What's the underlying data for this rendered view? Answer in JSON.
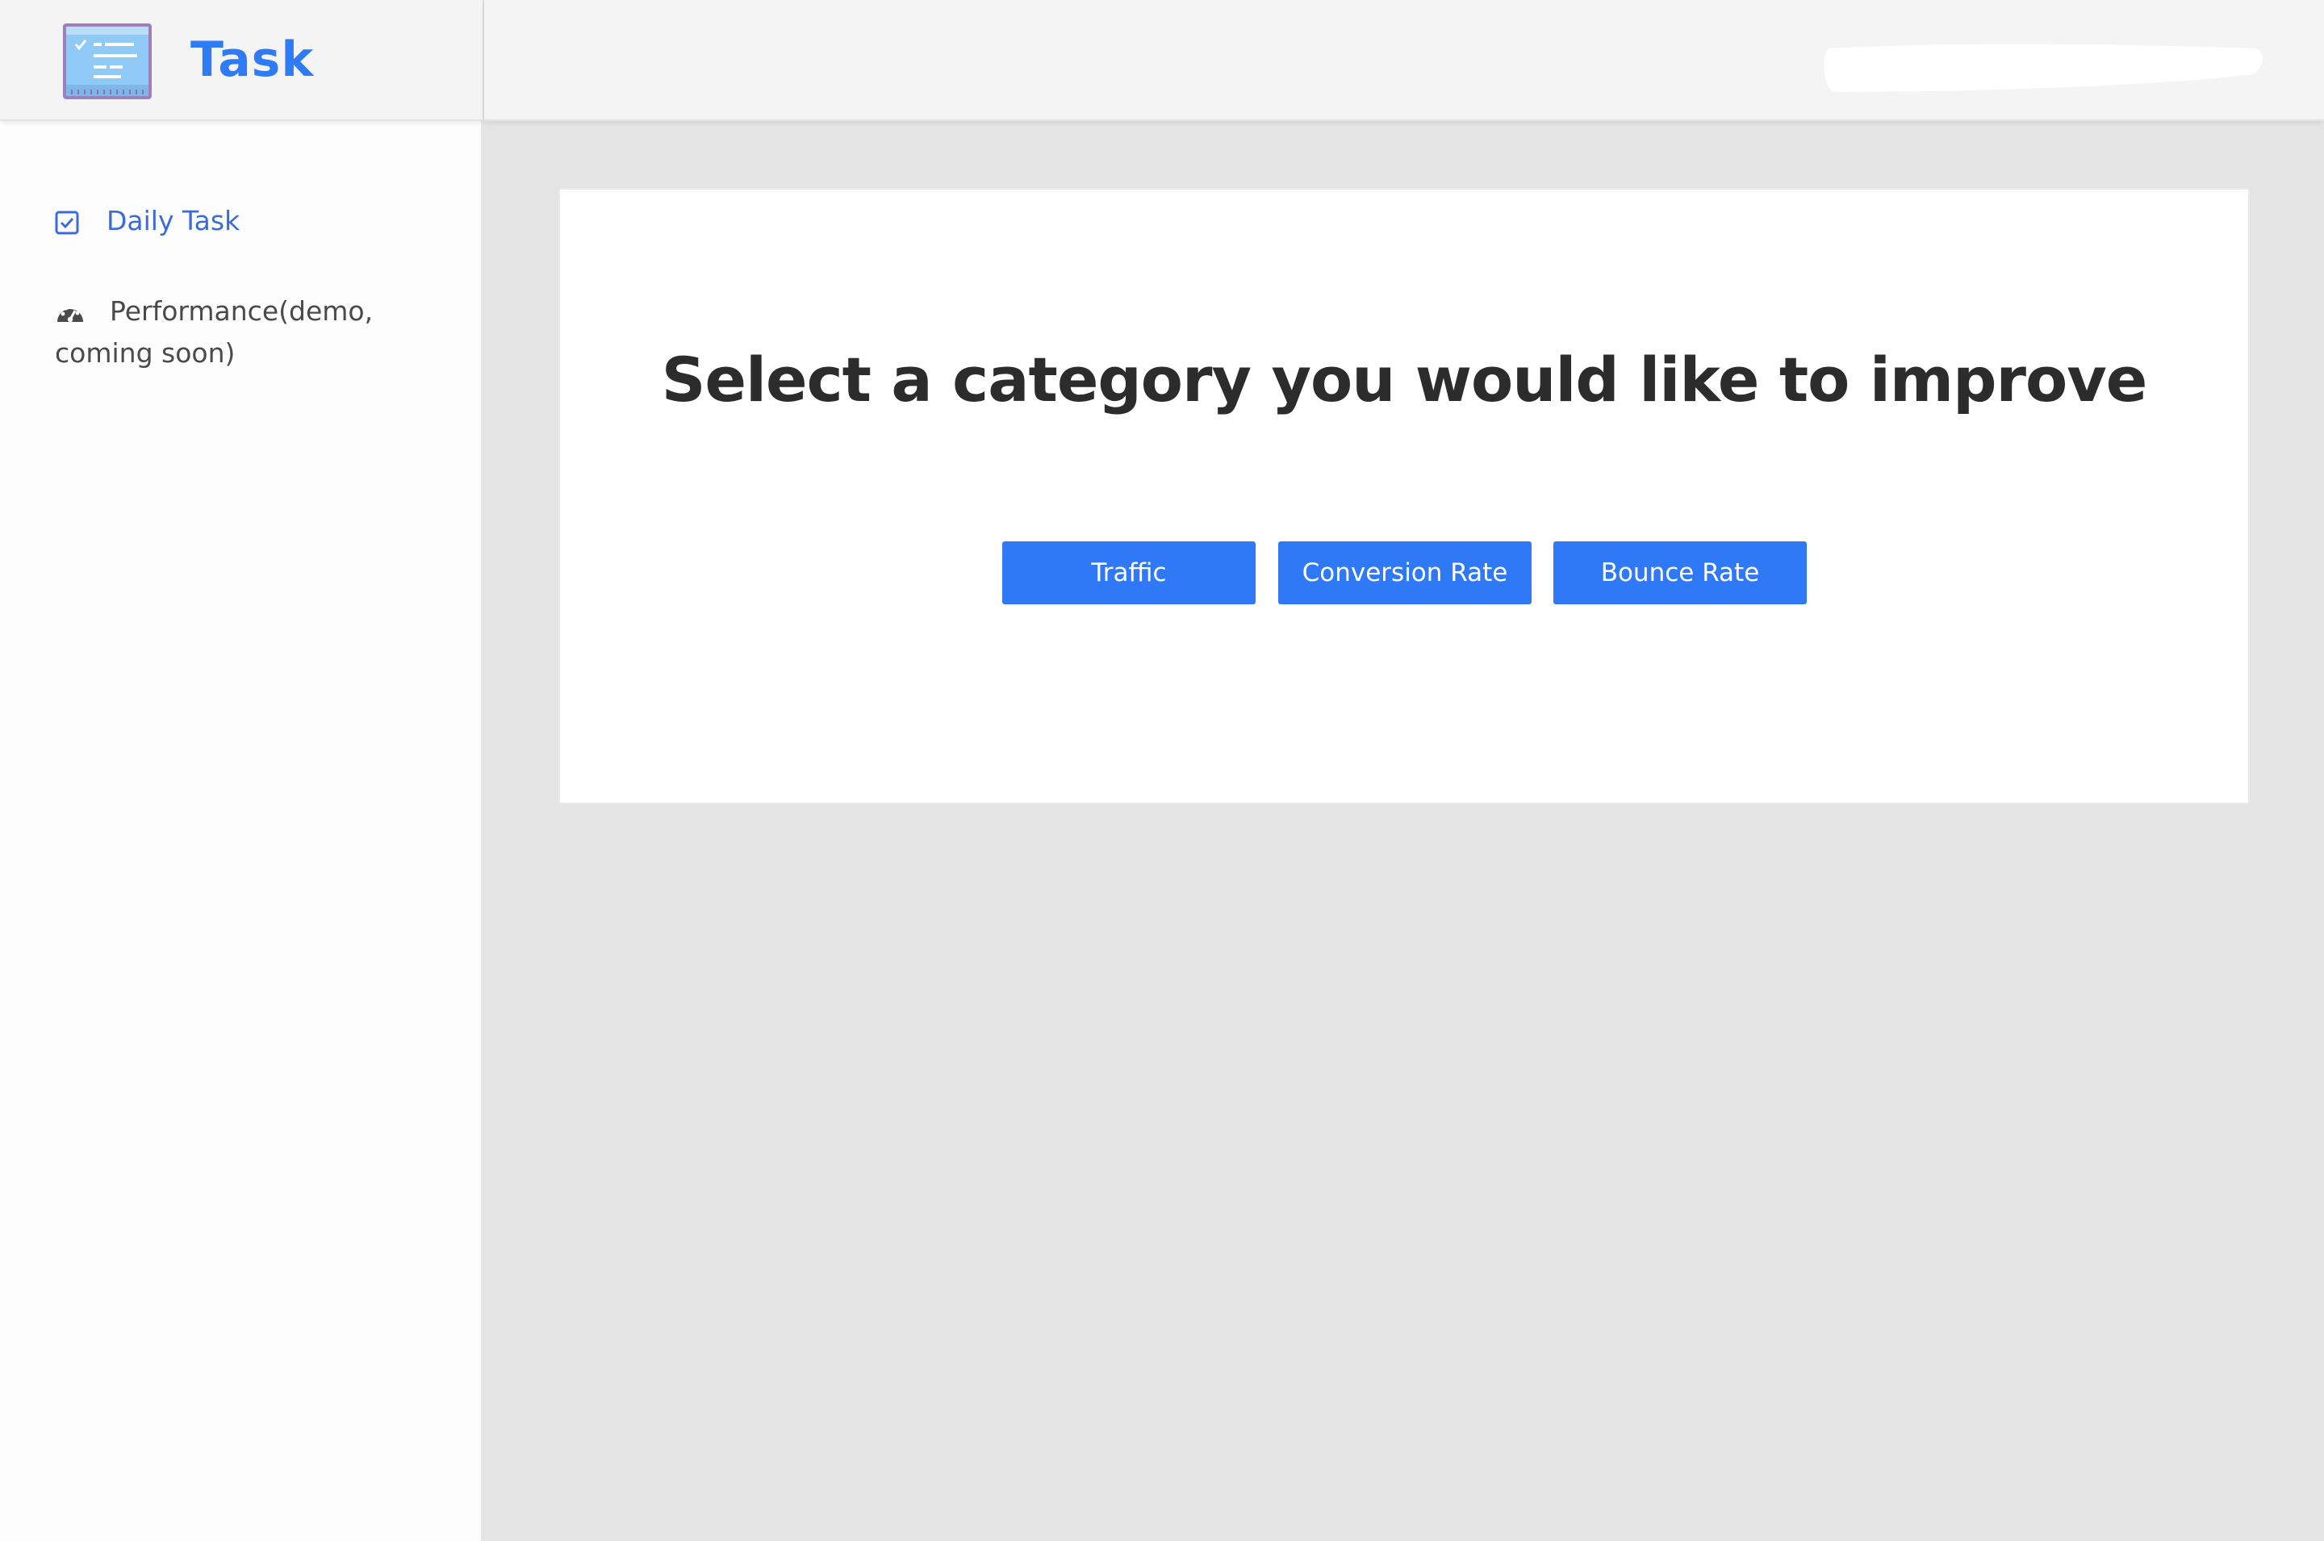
{
  "app": {
    "title": "Task",
    "brand_color": "#2f7bf5"
  },
  "sidebar": {
    "items": [
      {
        "label": "Daily Task",
        "icon": "checkbox-checked-icon",
        "active": true
      },
      {
        "label": "Performance(demo, coming soon)",
        "icon": "dashboard-gauge-icon",
        "active": false
      }
    ]
  },
  "header": {
    "user_area": "redacted"
  },
  "main": {
    "heading": "Select a category you would like to improve",
    "buttons": [
      {
        "label": "Traffic"
      },
      {
        "label": "Conversion Rate"
      },
      {
        "label": "Bounce Rate"
      }
    ],
    "button_color": "#2f79f6"
  }
}
